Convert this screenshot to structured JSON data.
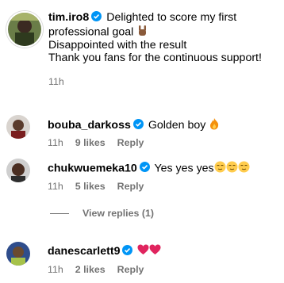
{
  "post_caption": {
    "username": "tim.iro8",
    "line1": "Delighted to score my first",
    "line2": "professional goal",
    "line3": "Disappointed with the result",
    "line4": "Thank you fans for the continuous support!",
    "time": "11h"
  },
  "comments": [
    {
      "username": "bouba_darkoss",
      "text": "Golden boy",
      "time": "11h",
      "likes": "9 likes",
      "reply_label": "Reply"
    },
    {
      "username": "chukwuemeka10",
      "text": "Yes yes yes",
      "time": "11h",
      "likes": "5 likes",
      "reply_label": "Reply"
    },
    {
      "username": "danescarlett9",
      "text": "",
      "time": "11h",
      "likes": "2 likes",
      "reply_label": "Reply"
    }
  ],
  "view_replies": "View replies (1)",
  "colors": {
    "verified_blue": "#0095f6",
    "meta_gray": "#737373",
    "heart_red": "#e0245e"
  },
  "icons": {
    "verified": "verified-badge-icon",
    "rock_hand": "rock-hand-emoji",
    "fire": "fire-emoji",
    "relieved_face": "relieved-face-emoji",
    "heart": "red-heart-emoji"
  }
}
